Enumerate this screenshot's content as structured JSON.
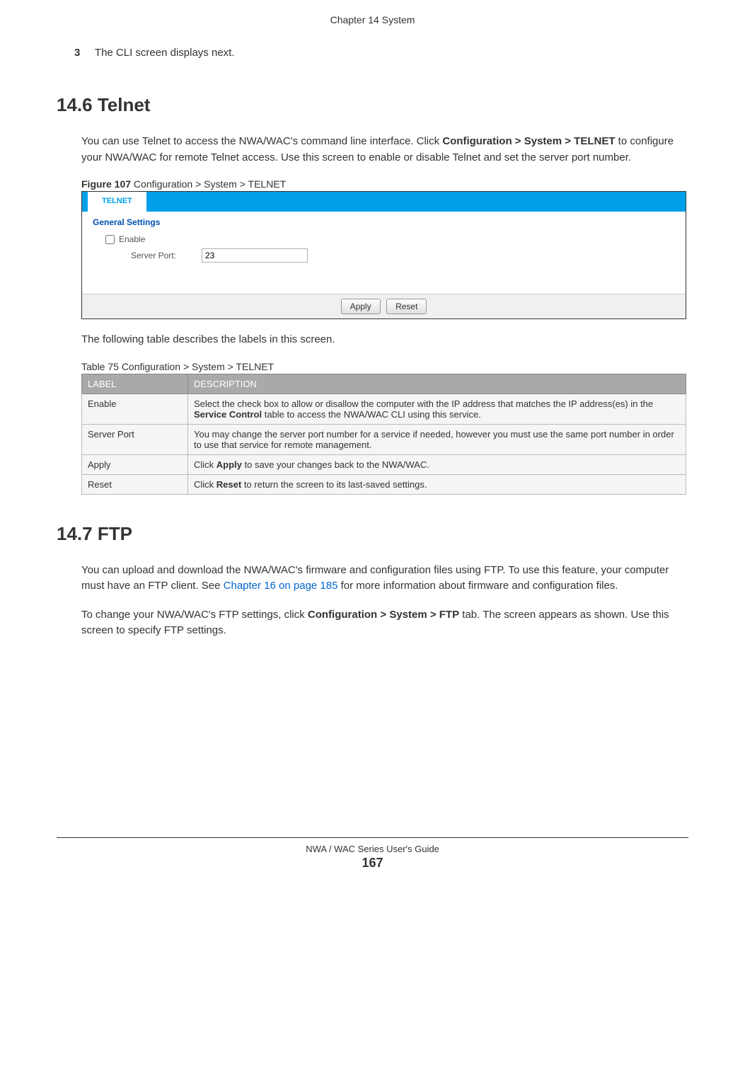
{
  "header": {
    "chapter": "Chapter 14 System"
  },
  "step3": {
    "number": "3",
    "text": "The CLI screen displays next."
  },
  "section_14_6": {
    "heading": "14.6  Telnet",
    "para1_pre": "You can use Telnet to access the NWA/WAC's command line interface. Click ",
    "para1_bold": "Configuration > System > TELNET",
    "para1_post": " to configure your NWA/WAC for remote Telnet access. Use this screen to enable or disable Telnet and set the server port number.",
    "figure_label_bold": "Figure 107",
    "figure_label_text": "   Configuration > System > TELNET",
    "screenshot": {
      "tab": "TELNET",
      "heading": "General Settings",
      "enable_label": "Enable",
      "server_port_label": "Server Port:",
      "server_port_value": "23",
      "apply_btn": "Apply",
      "reset_btn": "Reset"
    },
    "table_intro": "The following table describes the labels in this screen.",
    "table_caption": "Table 75   Configuration > System > TELNET",
    "table": {
      "headers": {
        "col1": "LABEL",
        "col2": "DESCRIPTION"
      },
      "rows": [
        {
          "label": "Enable",
          "desc_pre": "Select the check box to allow or disallow the computer with the IP address that matches the IP address(es) in the ",
          "desc_bold": "Service Control",
          "desc_post": " table to access the NWA/WAC CLI using this service."
        },
        {
          "label": "Server Port",
          "desc_pre": "You may change the server port number for a service if needed, however you must use the same port number in order to use that service for remote management.",
          "desc_bold": "",
          "desc_post": ""
        },
        {
          "label": "Apply",
          "desc_pre": "Click ",
          "desc_bold": "Apply",
          "desc_post": " to save your changes back to the NWA/WAC."
        },
        {
          "label": "Reset",
          "desc_pre": "Click ",
          "desc_bold": "Reset",
          "desc_post": " to return the screen to its last-saved settings."
        }
      ]
    }
  },
  "section_14_7": {
    "heading": "14.7  FTP",
    "para1_pre": "You can upload and download the NWA/WAC's firmware and configuration files using FTP. To use this feature, your computer must have an FTP client. See ",
    "para1_link": "Chapter 16 on page 185",
    "para1_post": " for more information about firmware and configuration files.",
    "para2_pre": "To change your NWA/WAC's FTP settings, click ",
    "para2_bold": "Configuration > System > FTP",
    "para2_post": " tab. The screen appears as shown. Use this screen to specify FTP settings."
  },
  "footer": {
    "guide": "NWA / WAC Series User's Guide",
    "page": "167"
  }
}
